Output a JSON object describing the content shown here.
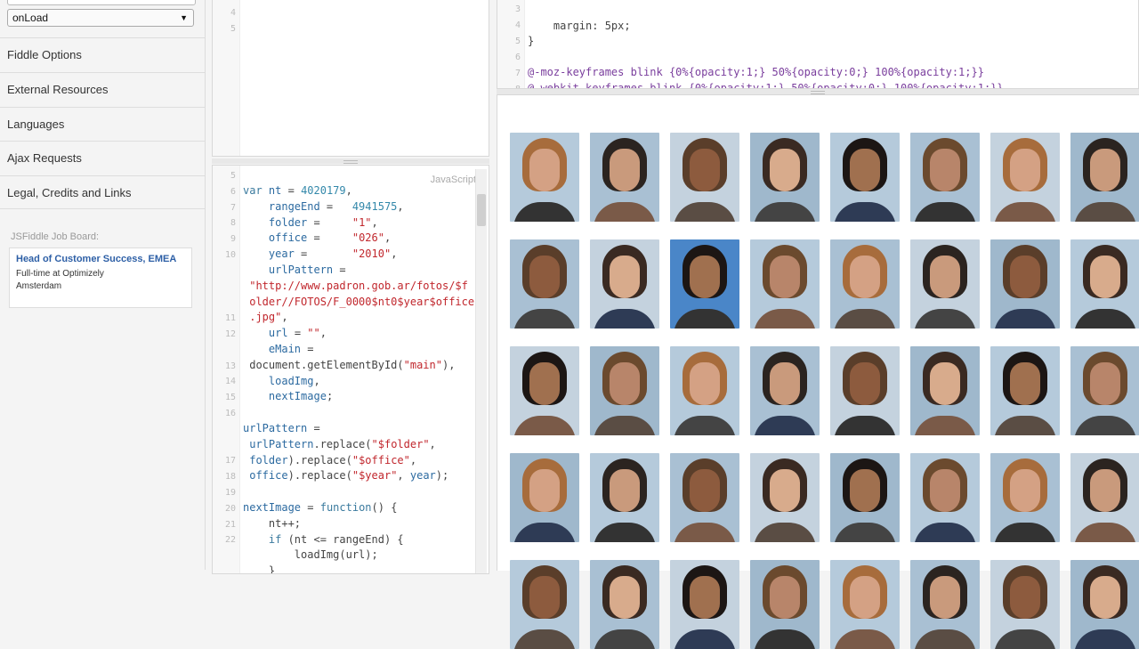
{
  "sidebar": {
    "load_select": "onLoad",
    "items": [
      "Fiddle Options",
      "External Resources",
      "Languages",
      "Ajax Requests",
      "Legal, Credits and Links"
    ],
    "job_board": {
      "label": "JSFiddle Job Board:",
      "title": "Head of Customer Success, EMEA",
      "line1": "Full-time at Optimizely",
      "line2": "Amsterdam"
    }
  },
  "html_panel": {
    "line_numbers": [
      "4",
      "5"
    ]
  },
  "css_panel": {
    "line_numbers": [
      "3",
      "4",
      "5",
      "6",
      "7",
      "8"
    ],
    "lines": [
      "",
      "    margin: 5px;",
      "}",
      "",
      "@-moz-keyframes blink {0%{opacity:1;} 50%{opacity:0;} 100%{opacity:1;}}",
      "@-webkit-keyframes blink {0%{opacity:1;} 50%{opacity:0;} 100%{opacity:1;}}"
    ]
  },
  "js_panel": {
    "language": "JavaScript",
    "line_numbers": [
      "5",
      "6",
      "7",
      "8",
      "9",
      "10",
      "",
      "",
      "",
      "11",
      "12",
      "",
      "13",
      "14",
      "15",
      "16",
      "",
      "",
      "17",
      "18",
      "19",
      "20",
      "21",
      "22"
    ]
  },
  "result_panel": {
    "photo_colors": {
      "skin": [
        "#c99a7c",
        "#d4a184",
        "#b8856a",
        "#a0704f",
        "#d8ab8c",
        "#8d5b3e"
      ],
      "hair": [
        "#3a2a22",
        "#1c1614",
        "#6b4a2e",
        "#a76c3c",
        "#2b2420",
        "#5a3e2a"
      ],
      "bg": [
        "#b5cadb",
        "#a9c0d3",
        "#c4d2de",
        "#9fb8cc"
      ]
    }
  }
}
